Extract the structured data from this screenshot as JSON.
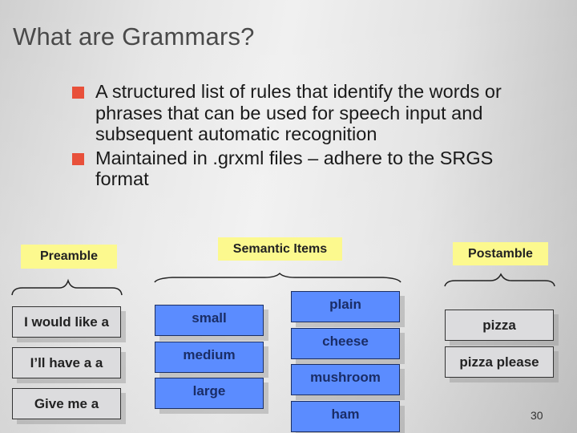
{
  "slide": {
    "title": "What are Grammars?",
    "bullets": [
      "A structured list of rules that identify the words or phrases that can be used for speech input and subsequent automatic recognition",
      "Maintained in .grxml files – adhere to the SRGS format"
    ],
    "bullet_color": "#e8503a",
    "page_number": "30"
  },
  "diagram": {
    "label_color": "#fcf98e",
    "preamble": {
      "label": "Preamble",
      "items": [
        "I would like a",
        "I’ll have a a",
        "Give me a"
      ]
    },
    "semantic_items": {
      "label": "Semantic Items",
      "color": "#5b8cff",
      "sizes": [
        "small",
        "medium",
        "large"
      ],
      "toppings": [
        "plain",
        "cheese",
        "mushroom",
        "ham"
      ]
    },
    "postamble": {
      "label": "Postamble",
      "items": [
        "pizza",
        "pizza please"
      ]
    }
  }
}
